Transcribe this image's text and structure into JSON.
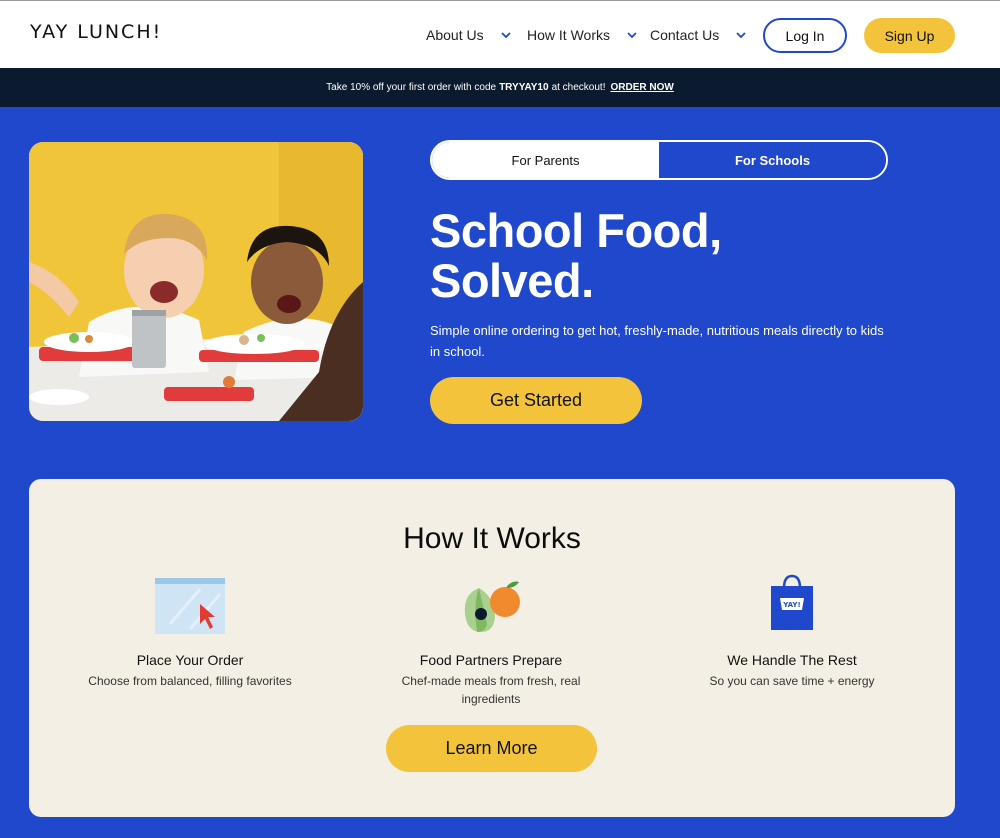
{
  "header": {
    "logo": "YAY LUNCH!",
    "nav": [
      {
        "label": "About Us"
      },
      {
        "label": "How It Works"
      },
      {
        "label": "Contact Us"
      }
    ],
    "login_label": "Log In",
    "signup_label": "Sign Up"
  },
  "promo": {
    "text_before": "Take 10% off your first order with code",
    "code": "TRYYAY10",
    "text_after": "at checkout!",
    "link": "ORDER NOW"
  },
  "hero": {
    "toggle": {
      "parents": "For Parents",
      "schools": "For Schools",
      "active": "For Parents"
    },
    "title_line1": "School Food,",
    "title_line2": "Solved.",
    "subtitle": "Simple online ordering to get hot, freshly-made, nutritious meals directly to kids in school.",
    "cta": "Get Started"
  },
  "how_it_works": {
    "title": "How It Works",
    "steps": [
      {
        "title": "Place Your Order",
        "desc": "Choose from balanced, filling favorites",
        "icon": "order-screen-icon"
      },
      {
        "title": "Food Partners Prepare",
        "desc": "Chef-made meals from fresh, real ingredients",
        "icon": "fruit-icon"
      },
      {
        "title": "We Handle The Rest",
        "desc": "So you can save time + energy",
        "icon": "shopping-bag-icon"
      }
    ],
    "bag_label": "YAY!",
    "cta": "Learn More"
  },
  "colors": {
    "brand_blue": "#1f48cc",
    "yellow": "#f2c33b",
    "navy": "#0b1a2e",
    "cream": "#f4efe4"
  }
}
